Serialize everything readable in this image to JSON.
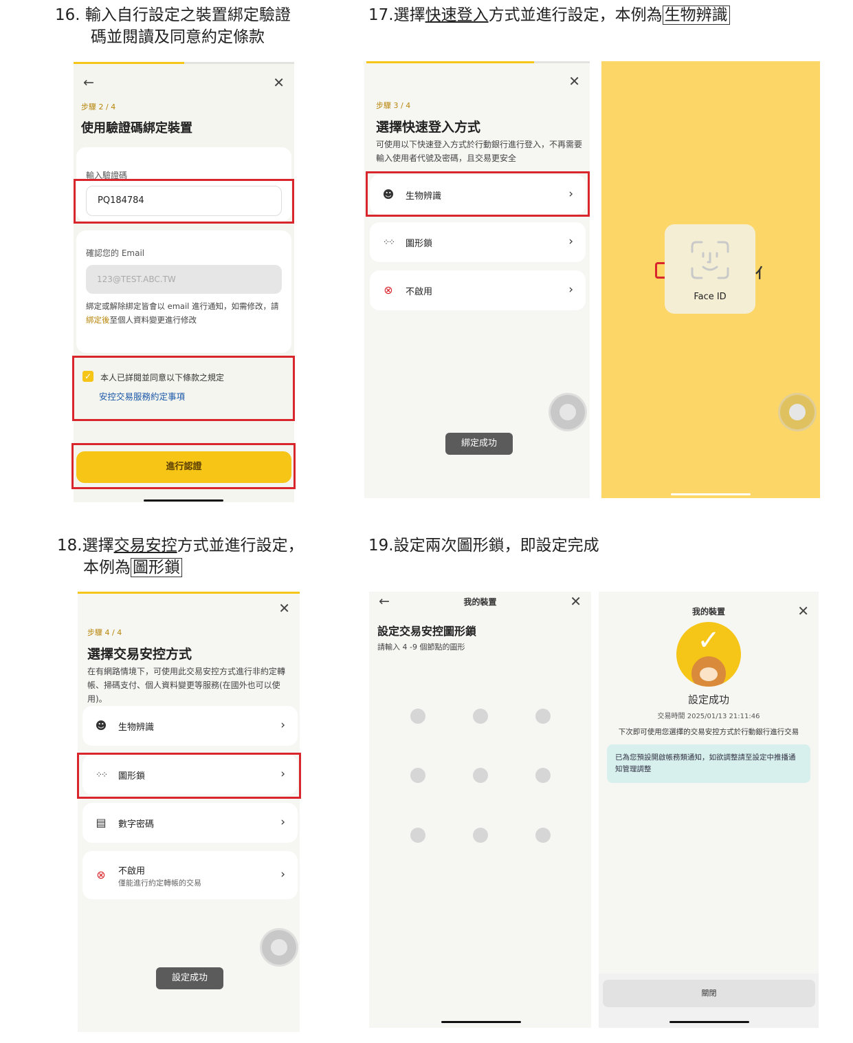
{
  "s16": {
    "heading_l1": "16.  輸入自行設定之裝置綁定驗證",
    "heading_l2": "碼並閱讀及同意約定條款",
    "step": "步驟 2 / 4",
    "title": "使用驗證碼綁定裝置",
    "code_label": "輸入驗證碼",
    "code_value": "PQ184784",
    "email_label": "確認您的 Email",
    "email_value": "123@TEST.ABC.TW",
    "note_a": "綁定或解除綁定皆會以 email 進行通知，如需修改，請",
    "note_link": "綁定後",
    "note_b": "至個人資料變更進行修改",
    "agree_text": "本人已詳閱並同意以下條款之規定",
    "terms_link": "安控交易服務約定事項",
    "submit_label": "進行認證"
  },
  "s17": {
    "heading_prefix": "17.選擇",
    "heading_u": "快速登入",
    "heading_mid": "方式並進行設定，本例為",
    "heading_box": "生物辨識",
    "step": "步驟 3 / 4",
    "title": "選擇快速登入方式",
    "desc": "可使用以下快速登入方式於行動銀行進行登入，不再需要輸入使用者代號及密碼，且交易更安全",
    "options": [
      "生物辨識",
      "圖形鎖",
      "不啟用"
    ],
    "toast": "綁定成功",
    "faceid_label": "Face ID"
  },
  "s18": {
    "heading_l1_prefix": "18.選擇",
    "heading_l1_u": "交易安控",
    "heading_l1_suffix": "方式並進行設定，",
    "heading_l2_prefix": "本例為",
    "heading_l2_box": "圖形鎖",
    "step": "步驟 4 / 4",
    "title": "選擇交易安控方式",
    "desc": "在有網路情境下，可使用此交易安控方式進行非約定轉帳、掃碼支付、個人資料變更等服務(在國外也可以使用)。",
    "options": [
      "生物辨識",
      "圖形鎖",
      "數字密碼",
      "不啟用"
    ],
    "option4_sub": "僅能進行約定轉帳的交易",
    "toast": "設定成功"
  },
  "s19": {
    "heading": "19.設定兩次圖形鎖，即設定完成",
    "nav_title": "我的裝置",
    "title": "設定交易安控圖形鎖",
    "hint": "請輸入 4 -9 個節點的圖形",
    "nav_title2": "我的裝置",
    "success_title": "設定成功",
    "tx_time": "交易時間 2025/01/13 21:11:46",
    "next_text": "下次即可使用您選擇的交易安控方式於行動銀行進行交易",
    "notice": "已為您預設開啟帳務類通知，如欲調整請至設定中推播通知管理調整",
    "close_label": "關閉"
  },
  "colors": {
    "accent": "#f5c518",
    "red_box": "#d9262c",
    "link": "#1a56a8",
    "face_bg": "#fcd666"
  }
}
